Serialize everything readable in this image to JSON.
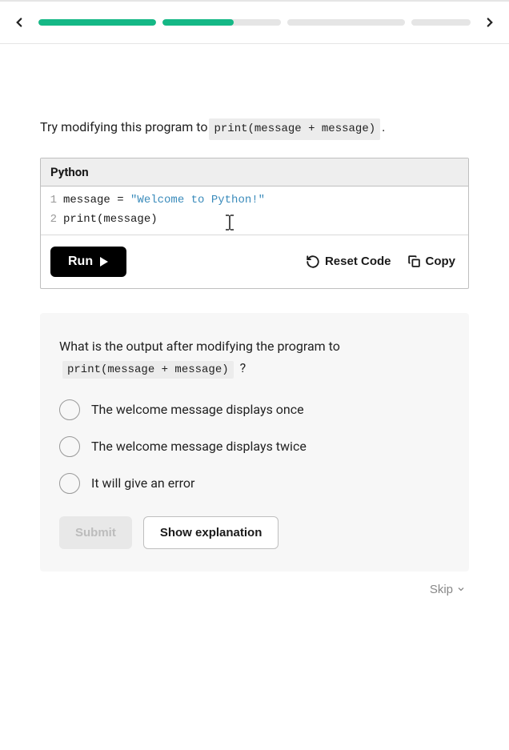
{
  "progress": [
    {
      "fill": 100
    },
    {
      "fill": 60
    },
    {
      "fill": 0
    },
    {
      "fill": 0
    }
  ],
  "instruction": {
    "prefix": "Try modifying this program to ",
    "code": "print(message + message)",
    "suffix": "."
  },
  "editor": {
    "language": "Python",
    "lines": [
      {
        "num": "1",
        "pre": "message = ",
        "str": "\"Welcome to Python!\""
      },
      {
        "num": "2",
        "pre": "print(message)",
        "str": ""
      }
    ]
  },
  "actions": {
    "run": "Run",
    "reset": "Reset Code",
    "copy": "Copy"
  },
  "quiz": {
    "question_prefix": "What is the output after modifying the program to",
    "question_code": "print(message + message)",
    "question_suffix": "?",
    "options": [
      "The welcome message displays once",
      "The welcome message displays twice",
      "It will give an error"
    ],
    "submit": "Submit",
    "explain": "Show explanation"
  },
  "skip": "Skip"
}
